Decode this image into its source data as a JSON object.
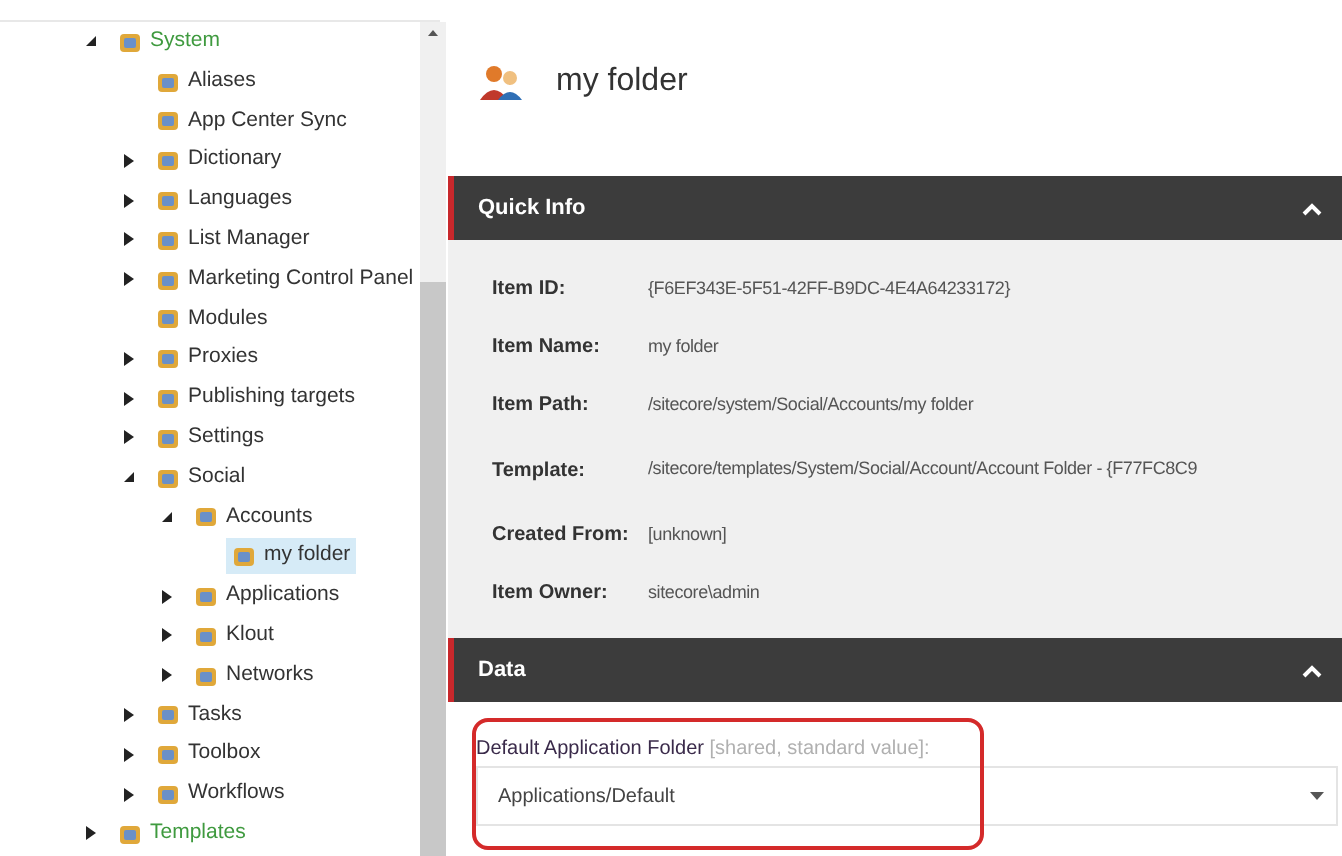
{
  "tree": [
    {
      "label": "System",
      "expanded": true,
      "selected": false,
      "color": "#3f9a3f",
      "children": [
        {
          "label": "Aliases",
          "selected": false,
          "color": "#333333"
        },
        {
          "label": "App Center Sync",
          "selected": false,
          "color": "#333333"
        },
        {
          "label": "Dictionary",
          "expanded": false,
          "selected": false,
          "color": "#333333"
        },
        {
          "label": "Languages",
          "expanded": false,
          "selected": false,
          "color": "#333333"
        },
        {
          "label": "List Manager",
          "expanded": false,
          "selected": false,
          "color": "#333333"
        },
        {
          "label": "Marketing Control Panel",
          "expanded": false,
          "selected": false,
          "color": "#333333"
        },
        {
          "label": "Modules",
          "selected": false,
          "color": "#333333"
        },
        {
          "label": "Proxies",
          "expanded": false,
          "selected": false,
          "color": "#333333"
        },
        {
          "label": "Publishing targets",
          "expanded": false,
          "selected": false,
          "color": "#333333"
        },
        {
          "label": "Settings",
          "expanded": false,
          "selected": false,
          "color": "#333333"
        },
        {
          "label": "Social",
          "expanded": true,
          "selected": false,
          "color": "#333333",
          "children": [
            {
              "label": "Accounts",
              "expanded": true,
              "selected": false,
              "color": "#333333",
              "children": [
                {
                  "label": "my folder",
                  "selected": true,
                  "color": "#333333"
                }
              ]
            },
            {
              "label": "Applications",
              "expanded": false,
              "selected": false,
              "color": "#333333"
            },
            {
              "label": "Klout",
              "expanded": false,
              "selected": false,
              "color": "#333333"
            },
            {
              "label": "Networks",
              "expanded": false,
              "selected": false,
              "color": "#333333"
            }
          ]
        },
        {
          "label": "Tasks",
          "expanded": false,
          "selected": false,
          "color": "#333333"
        },
        {
          "label": "Toolbox",
          "expanded": false,
          "selected": false,
          "color": "#333333"
        },
        {
          "label": "Workflows",
          "expanded": false,
          "selected": false,
          "color": "#333333"
        }
      ]
    },
    {
      "label": "Templates",
      "expanded": false,
      "selected": false,
      "color": "#3f9a3f"
    }
  ],
  "header": {
    "title": "my folder"
  },
  "quick_info": {
    "title": "Quick Info",
    "expanded": true,
    "rows": [
      {
        "label": "Item ID:",
        "value": "{F6EF343E-5F51-42FF-B9DC-4E4A64233172}"
      },
      {
        "label": "Item Name:",
        "value": "my folder"
      },
      {
        "label": "Item Path:",
        "value": "/sitecore/system/Social/Accounts/my folder"
      },
      {
        "label": "Template:",
        "value": "/sitecore/templates/System/Social/Account/Account Folder - {F77FC8C9"
      },
      {
        "label": "Created From:",
        "value": "[unknown]"
      },
      {
        "label": "Item Owner:",
        "value": "sitecore\\admin"
      }
    ]
  },
  "data_section": {
    "title": "Data",
    "expanded": true,
    "field": {
      "label": "Default Application Folder",
      "note": "[shared, standard value]:",
      "value": "Applications/Default"
    }
  }
}
